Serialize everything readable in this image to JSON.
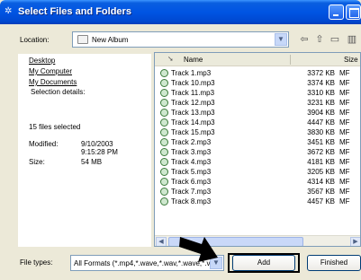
{
  "window": {
    "title": "Select Files and Folders"
  },
  "location": {
    "label": "Location:",
    "value": "New Album"
  },
  "left_pane": {
    "links": [
      "Desktop",
      "My Computer",
      "My Documents"
    ],
    "details_heading": "Selection details:",
    "files_selected": "15 files selected",
    "modified_label": "Modified:",
    "modified_date": "9/10/2003",
    "modified_time": "9:15:28 PM",
    "size_label": "Size:",
    "size_value": "54 MB"
  },
  "file_list": {
    "columns": {
      "name": "Name",
      "size": "Size"
    },
    "rows": [
      {
        "name": "Track 1.mp3",
        "size": "3372 KB",
        "type": "MF"
      },
      {
        "name": "Track 10.mp3",
        "size": "3374 KB",
        "type": "MF"
      },
      {
        "name": "Track 11.mp3",
        "size": "3310 KB",
        "type": "MF"
      },
      {
        "name": "Track 12.mp3",
        "size": "3231 KB",
        "type": "MF"
      },
      {
        "name": "Track 13.mp3",
        "size": "3904 KB",
        "type": "MF"
      },
      {
        "name": "Track 14.mp3",
        "size": "4447 KB",
        "type": "MF"
      },
      {
        "name": "Track 15.mp3",
        "size": "3830 KB",
        "type": "MF"
      },
      {
        "name": "Track 2.mp3",
        "size": "3451 KB",
        "type": "MF"
      },
      {
        "name": "Track 3.mp3",
        "size": "3672 KB",
        "type": "MF"
      },
      {
        "name": "Track 4.mp3",
        "size": "4181 KB",
        "type": "MF"
      },
      {
        "name": "Track 5.mp3",
        "size": "3205 KB",
        "type": "MF"
      },
      {
        "name": "Track 6.mp3",
        "size": "4314 KB",
        "type": "MF"
      },
      {
        "name": "Track 7.mp3",
        "size": "3567 KB",
        "type": "MF"
      },
      {
        "name": "Track 8.mp3",
        "size": "4457 KB",
        "type": "MF"
      }
    ]
  },
  "file_types": {
    "label": "File types:",
    "value": "All Formats  (*.mp4,*.wave,*.wav,*.wave,*.v"
  },
  "buttons": {
    "add": "Add",
    "finished": "Finished"
  },
  "colors": {
    "title_bar": "#0054e3",
    "dialog_bg": "#ece9d8",
    "button_border": "#003c74"
  }
}
